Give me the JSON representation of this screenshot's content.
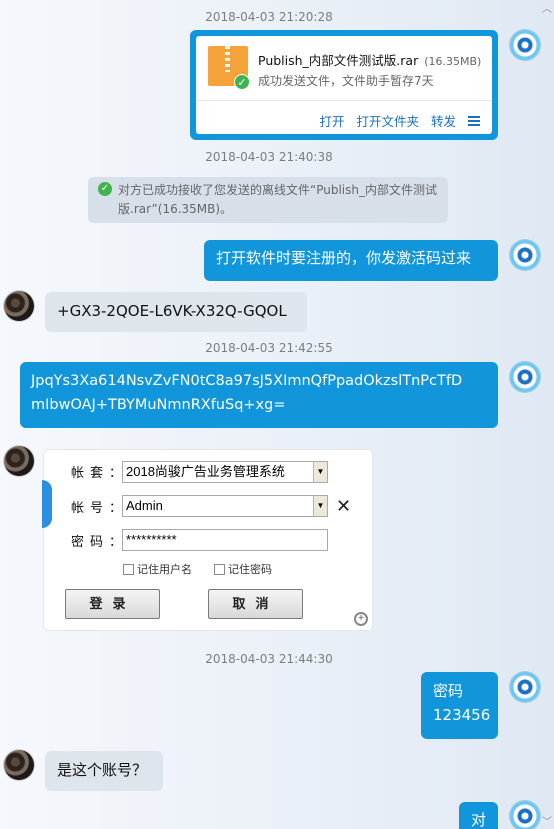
{
  "timestamps": [
    "2018-04-03 21:20:28",
    "2018-04-03 21:40:38",
    "2018-04-03 21:42:55",
    "2018-04-03 21:44:30"
  ],
  "file_card": {
    "name": "Publish_内部文件测试版.rar",
    "size": "(16.35MB)",
    "status": "成功发送文件，文件助手暂存7天",
    "actions": {
      "open": "打开",
      "open_folder": "打开文件夹",
      "forward": "转发"
    }
  },
  "system_notice": "对方已成功接收了您发送的离线文件“Publish_内部文件测试版.rar”(16.35MB)。",
  "messages": {
    "m1": "打开软件时要注册的，你发激活码过来",
    "m2": "+GX3-2QOE-L6VK-X32Q-GQOL",
    "m3_line1": "JpqYs3Xa614NsvZvFN0tC8a97sJ5XImnQfPpadOkzslTnPcTfD",
    "m3_line2": "mIbwOAJ+TBYMuNmnRXfuSq+xg=",
    "m4_line1": "密码",
    "m4_line2": "123456",
    "m5": "是这个账号？",
    "m6": "对"
  },
  "login_screenshot": {
    "account_set_label": "帐套：",
    "account_set_value": "2018尚骏广告业务管理系统",
    "account_label": "帐号：",
    "account_value": "Admin",
    "password_label": "密码：",
    "password_value": "**********",
    "remember_user": "记住用户名",
    "remember_password": "记住密码",
    "login_button": "登录",
    "cancel_button": "取消"
  }
}
